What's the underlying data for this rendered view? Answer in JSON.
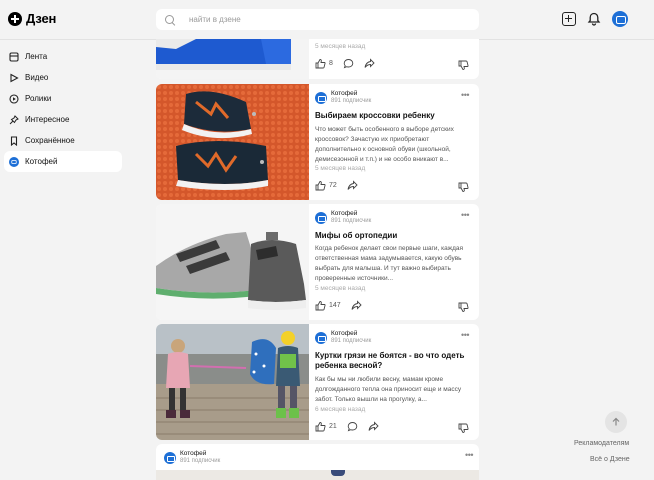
{
  "header": {
    "logo": "Дзен",
    "search_placeholder": "найти в дзене"
  },
  "sidebar": {
    "items": [
      {
        "label": "Лента",
        "icon": "feed-icon"
      },
      {
        "label": "Видео",
        "icon": "play-icon"
      },
      {
        "label": "Ролики",
        "icon": "shorts-icon"
      },
      {
        "label": "Интересное",
        "icon": "pin-icon"
      },
      {
        "label": "Сохранённое",
        "icon": "bookmark-icon"
      },
      {
        "label": "Котофей",
        "icon": "channel-avatar-icon",
        "active": true
      }
    ]
  },
  "cards": [
    {
      "time": "5 месяцев назад",
      "likes": "8"
    },
    {
      "channel": "Котофей",
      "subscribers": "891 подписчик",
      "title": "Выбираем кроссовки ребенку",
      "desc": "Что может быть особенного в выборе детских кроссовок? Зачастую их приобретают дополнительно к основной обуви (школьной, демисезонной и т.п.) и не особо вникают в...",
      "time": "5 месяцев назад",
      "likes": "72"
    },
    {
      "channel": "Котофей",
      "subscribers": "891 подписчик",
      "title": "Мифы об ортопедии",
      "desc": "Когда ребенок делает свои первые шаги, каждая ответственная мама задумывается, какую обувь выбрать для малыша. И тут важно выбирать проверенные источники...",
      "time": "5 месяцев назад",
      "likes": "147"
    },
    {
      "channel": "Котофей",
      "subscribers": "891 подписчик",
      "title": "Куртки грязи не боятся - во что одеть ребенка весной?",
      "desc": "Как бы мы ни любили весну, мамам кроме долгожданного тепла она приносит еще и массу забот. Только вышли на прогулку, а...",
      "time": "6 месяцев назад",
      "likes": "21"
    },
    {
      "channel": "Котофей",
      "subscribers": "891 подписчик"
    }
  ],
  "footer": {
    "advertisers": "Рекламодателям",
    "about": "Всё о Дзене"
  },
  "colors": {
    "accent": "#1d6fd6",
    "background": "#f3f3f3"
  }
}
